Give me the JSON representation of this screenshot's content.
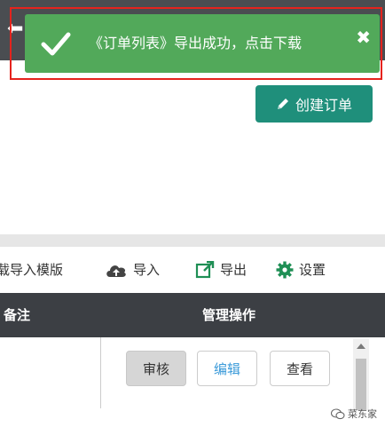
{
  "toast": {
    "message": "《订单列表》导出成功，点击下载",
    "check_icon": "check-icon",
    "close_symbol": "✖",
    "color": "#52a95a"
  },
  "header": {
    "back_symbol": "⬅",
    "create_order_label": "创建订单",
    "create_button_color": "#1f8f7b"
  },
  "toolbar": {
    "download_template_label": "载导入模版",
    "import_label": "导入",
    "export_label": "导出",
    "settings_label": "设置"
  },
  "table": {
    "headers": [
      "备注",
      "管理操作"
    ],
    "row_actions": [
      "审核",
      "编辑",
      "查看"
    ]
  },
  "watermark": {
    "text": "菜东家"
  },
  "highlight_color": "#e5231d"
}
